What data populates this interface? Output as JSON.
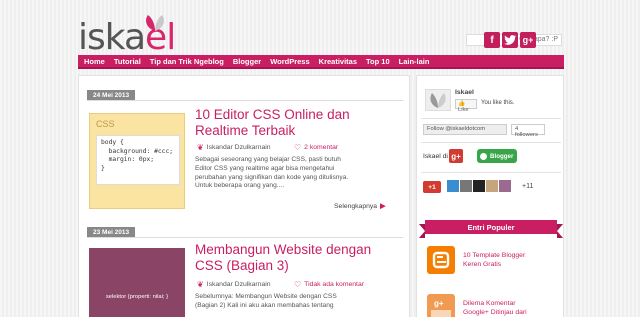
{
  "header": {
    "logo_part1": "iska",
    "logo_part2": "el",
    "search_placeholder": "Cari apa? :P"
  },
  "colors": {
    "brand": "#c91e62",
    "nav_bg": "#c91e62",
    "date_bg": "#888888"
  },
  "nav": [
    "Home",
    "Tutorial",
    "Tip dan Trik Ngeblog",
    "Blogger",
    "WordPress",
    "Kreativitas",
    "Top 10",
    "Lain-lain"
  ],
  "posts": [
    {
      "date": "24 Mei 2013",
      "title_l1": "10 Editor CSS Online dan",
      "title_l2": "Realtime Terbaik",
      "author": "Iskandar Dzulkarnain",
      "comments": "2 komentar",
      "excerpt_l1": "Sebagai seseorang yang belajar CSS, pasti butuh",
      "excerpt_l2": "Editor CSS yang realtime agar bisa mengetahui",
      "excerpt_l3": "perubahan yang signifikan dan kode yang ditulisnya.",
      "excerpt_l4": "Untuk beberapa orang yang....",
      "read_more": "Selengkapnya",
      "thumb_label": "CSS",
      "thumb_code": "body {\n  background: #ccc;\n  margin: 0px;\n}"
    },
    {
      "date": "23 Mei 2013",
      "title_l1": "Membangun Website dengan",
      "title_l2": "CSS (Bagian 3)",
      "author": "Iskandar Dzulkarnain",
      "comments": "Tidak ada komentar",
      "excerpt_l1": "Sebelumnya: Membangun Website dengan CSS",
      "excerpt_l2": "(Bagian 2) Kali ini aku akan membahas tentang",
      "thumb_label": "selektor {properti: nilai; }"
    }
  ],
  "sidebar": {
    "fb_name": "Iskael",
    "like_label": "Like",
    "like_text": "You like this.",
    "follow_label": "Follow @iskaeldotcom",
    "follower_count": "4 followers",
    "iskael_di": "Iskael di",
    "gplus_label": "g+",
    "blogger_label": "Blogger",
    "plus_one": "+1",
    "plus_more": "+11",
    "popular_title": "Entri Populer",
    "popular": [
      {
        "l1": "10 Template Blogger",
        "l2": "Keren Gratis",
        "icon": "blogger-icon"
      },
      {
        "l1": "Dilema Komentar",
        "l2": "Google+ Ditinjau dari",
        "icon": "gplus-icon"
      }
    ]
  }
}
